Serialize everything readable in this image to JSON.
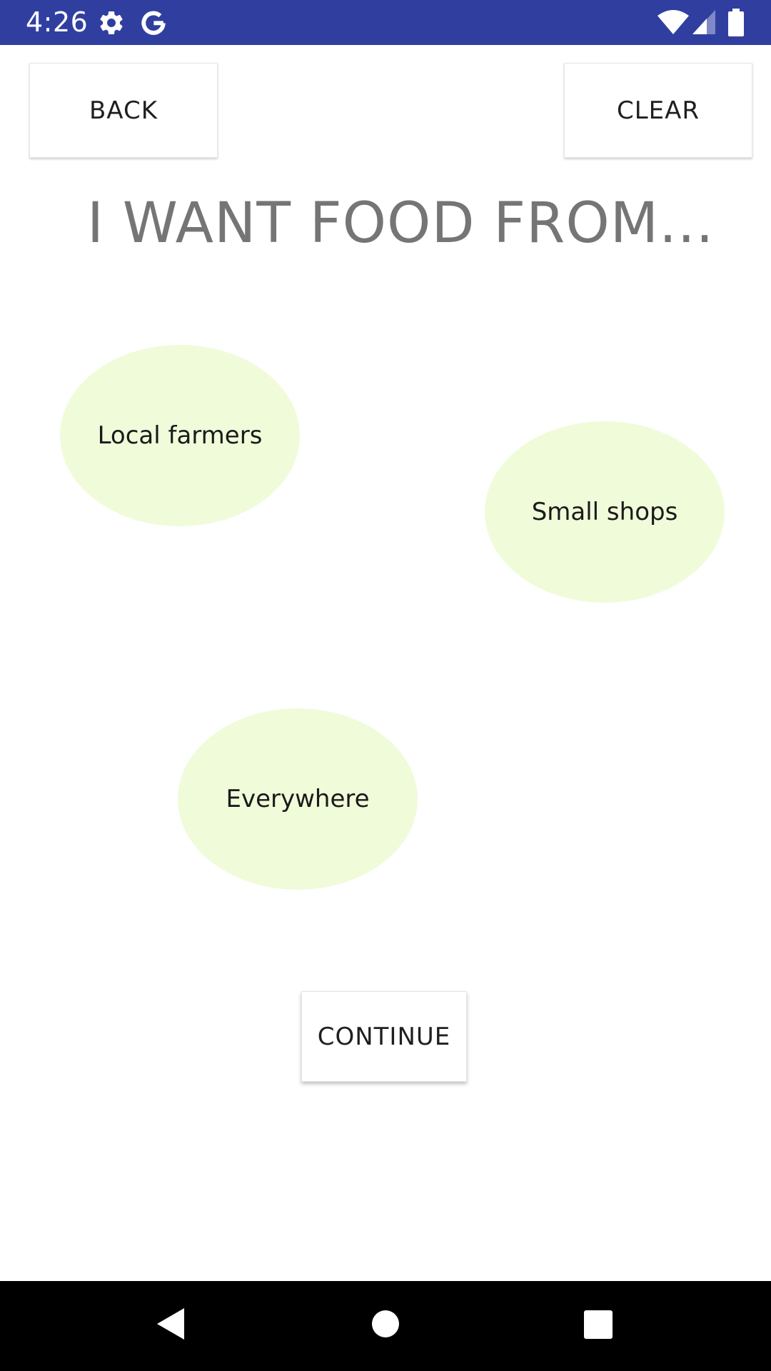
{
  "status_bar": {
    "time": "4:26",
    "background_color": "#303F9F",
    "left_icons": [
      "settings-icon",
      "google-icon"
    ],
    "right_icons": [
      "wifi-icon",
      "cellular-signal-icon",
      "battery-icon"
    ]
  },
  "header": {
    "back_label": "BACK",
    "clear_label": "CLEAR"
  },
  "prompt": {
    "title": "I WANT FOOD FROM..."
  },
  "options": [
    {
      "label": "Local farmers"
    },
    {
      "label": "Small shops"
    },
    {
      "label": "Everywhere"
    }
  ],
  "option_color": "#F0FBDA",
  "footer": {
    "continue_label": "CONTINUE"
  },
  "navigation_bar": {
    "buttons": [
      "back-icon",
      "home-icon",
      "recents-icon"
    ]
  }
}
